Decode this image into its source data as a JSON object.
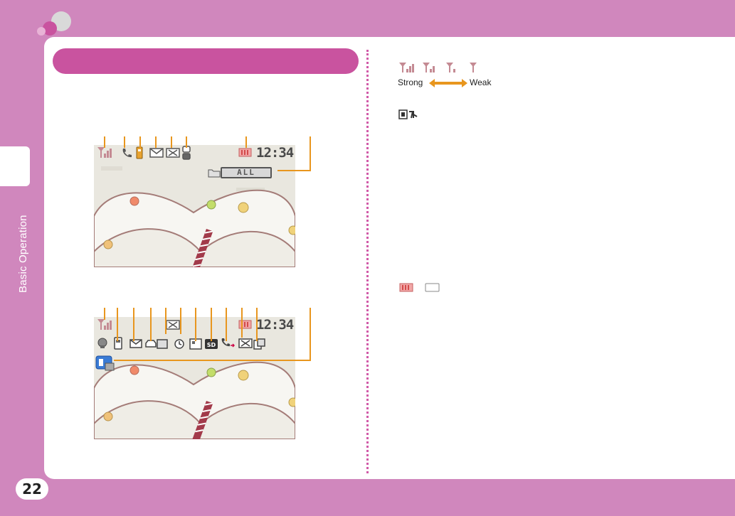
{
  "page": {
    "number": "22",
    "side_label": "Basic Operation"
  },
  "screen1": {
    "clock": "12:34",
    "all_label": "ALL"
  },
  "screen2": {
    "clock": "12:34"
  },
  "signal_legend": {
    "strong": "Strong",
    "weak": "Weak"
  },
  "colors": {
    "background": "#d087bd",
    "accent": "#c9539f",
    "callout": "#e8961e",
    "divider": "#d15aa8"
  },
  "icons": [
    "signal-icon",
    "call-icon",
    "battery-icon",
    "mail-icon",
    "clock-icon",
    "sd-icon",
    "out-of-area-icon"
  ]
}
